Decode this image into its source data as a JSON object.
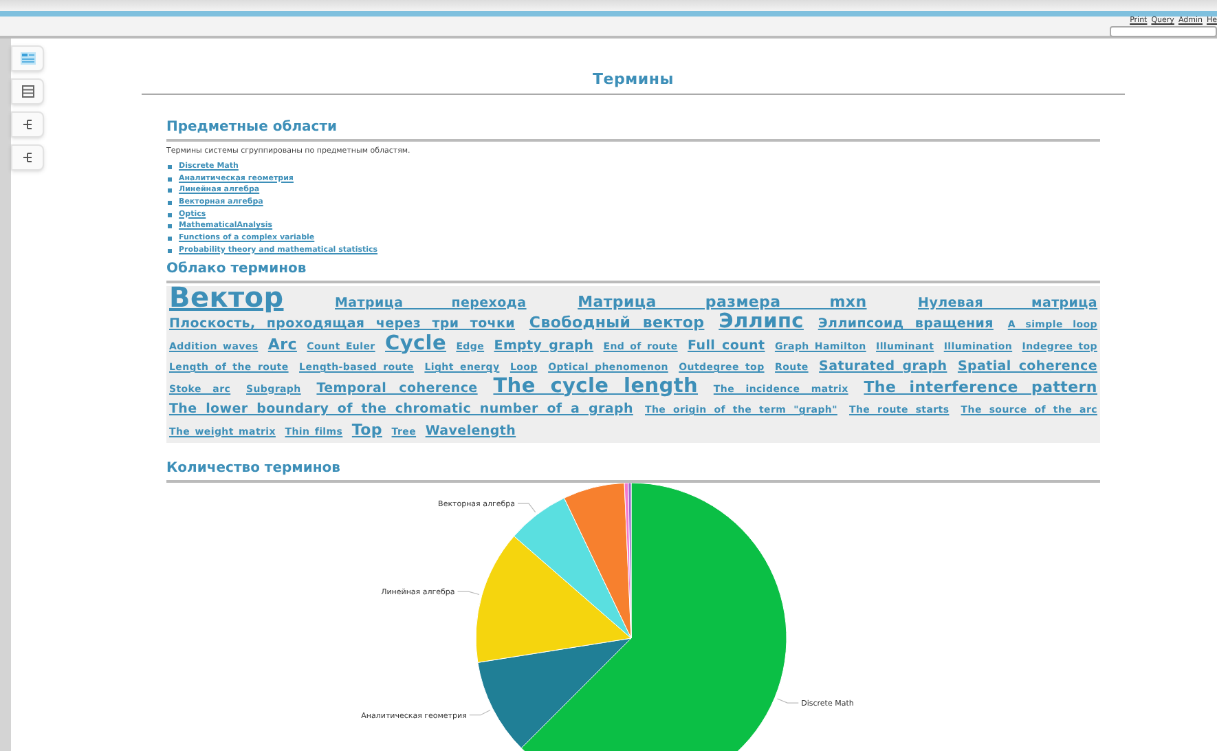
{
  "top_menu": [
    "Print",
    "Query",
    "Admin",
    "He"
  ],
  "page_title": "Термины",
  "sections": {
    "domains": {
      "title": "Предметные области",
      "description": "Термины системы сгруппированы по предметным областям.",
      "items": [
        "Discrete Math",
        "Аналитическая геометрия",
        "Линейная алгебра",
        "Векторная алгебра",
        "Optics",
        "MathematicalAnalysis",
        "Functions of a complex variable",
        "Probability theory and mathematical statistics"
      ]
    },
    "cloud": {
      "title": "Облако терминов",
      "terms": [
        {
          "text": "Вектор",
          "kind": "huge"
        },
        {
          "text": "Матрица перехода",
          "kind": "medium"
        },
        {
          "text": "Матрица размера mxn",
          "kind": "large"
        },
        {
          "text": "Нулевая матрица",
          "kind": "medium"
        },
        {
          "text": "Плоскость, проходящая через три точки",
          "kind": "medium"
        },
        {
          "text": "Свободный вектор",
          "kind": "large"
        },
        {
          "text": "Эллипс",
          "kind": "xlarge"
        },
        {
          "text": "Эллипсоид вращения",
          "kind": "medium"
        },
        {
          "text": "A simple loop",
          "kind": "small"
        },
        {
          "text": "Addition waves",
          "kind": "small"
        },
        {
          "text": "Arc",
          "kind": "large"
        },
        {
          "text": "Count Euler",
          "kind": "small"
        },
        {
          "text": "Cycle",
          "kind": "xlarge"
        },
        {
          "text": "Edge",
          "kind": "small"
        },
        {
          "text": "Empty graph",
          "kind": "medium"
        },
        {
          "text": "End of route",
          "kind": "small"
        },
        {
          "text": "Full count",
          "kind": "medium"
        },
        {
          "text": "Graph Hamilton",
          "kind": "small"
        },
        {
          "text": "Illuminant",
          "kind": "small"
        },
        {
          "text": "Illumination",
          "kind": "small"
        },
        {
          "text": "Indegree top",
          "kind": "small"
        },
        {
          "text": "Length of the route",
          "kind": "small"
        },
        {
          "text": "Length-based route",
          "kind": "small"
        },
        {
          "text": "Light energy",
          "kind": "small"
        },
        {
          "text": "Loop",
          "kind": "small"
        },
        {
          "text": "Optical phenomenon",
          "kind": "small"
        },
        {
          "text": "Outdegree top",
          "kind": "small"
        },
        {
          "text": "Route",
          "kind": "small"
        },
        {
          "text": "Saturated graph",
          "kind": "medium"
        },
        {
          "text": "Spatial coherence",
          "kind": "medium"
        },
        {
          "text": "Stoke arc",
          "kind": "small"
        },
        {
          "text": "Subgraph",
          "kind": "small"
        },
        {
          "text": "Temporal coherence",
          "kind": "medium"
        },
        {
          "text": "The cycle length",
          "kind": "xlarge"
        },
        {
          "text": "The incidence matrix",
          "kind": "small"
        },
        {
          "text": "The interference pattern",
          "kind": "large"
        },
        {
          "text": "The lower boundary of the chromatic number of a graph",
          "kind": "medium"
        },
        {
          "text": "The origin of the term \"graph\"",
          "kind": "small"
        },
        {
          "text": "The route starts",
          "kind": "small"
        },
        {
          "text": "The source of the arc",
          "kind": "small"
        },
        {
          "text": "The weight matrix",
          "kind": "small"
        },
        {
          "text": "Thin films",
          "kind": "small"
        },
        {
          "text": "Top",
          "kind": "large"
        },
        {
          "text": "Tree",
          "kind": "small"
        },
        {
          "text": "Wavelength",
          "kind": "medium"
        }
      ]
    },
    "count": {
      "title": "Количество терминов",
      "chart_data": {
        "type": "pie",
        "categories": [
          "Discrete Math",
          "Аналитическая геометрия",
          "Линейная алгебра",
          "Векторная алгебра",
          null,
          null,
          null
        ],
        "series": [
          {
            "values": [
              62.5,
              10,
              13.9,
              6.5,
              6.4,
              0.4,
              0.3
            ]
          }
        ],
        "colors": [
          "#0bbf45",
          "#207f96",
          "#f5d50e",
          "#5adfe0",
          "#f7802e",
          "#f27ad0",
          "#9966cc"
        ]
      }
    }
  }
}
